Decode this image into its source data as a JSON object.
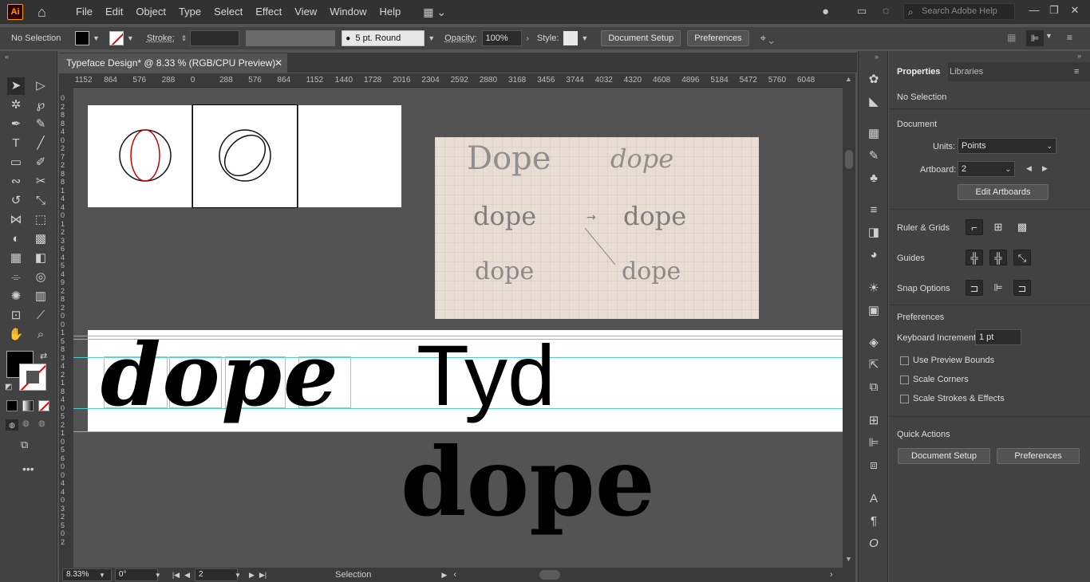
{
  "app": {
    "logo": "Ai"
  },
  "menu": [
    "File",
    "Edit",
    "Object",
    "Type",
    "Select",
    "Effect",
    "View",
    "Window",
    "Help"
  ],
  "search": {
    "placeholder": "Search Adobe Help"
  },
  "control": {
    "selection": "No Selection",
    "stroke_label": "Stroke:",
    "brush": "5 pt. Round",
    "opacity_label": "Opacity:",
    "opacity_value": "100%",
    "style_label": "Style:",
    "document_setup": "Document Setup",
    "preferences": "Preferences"
  },
  "document": {
    "tab_title": "Typeface Design* @ 8.33 % (RGB/CPU Preview)"
  },
  "ruler_top": [
    "1152",
    "864",
    "576",
    "288",
    "0",
    "288",
    "576",
    "864",
    "1152",
    "1440",
    "1728",
    "2016",
    "2304",
    "2592",
    "2880",
    "3168",
    "3456",
    "3744",
    "4032",
    "4320",
    "4608",
    "4896",
    "5184",
    "5472",
    "5760",
    "6048"
  ],
  "ruler_left": [
    "0",
    "2",
    "8",
    "8",
    "4",
    "0",
    "2",
    "7",
    "2",
    "8",
    "8",
    "1",
    "4",
    "4",
    "0",
    "1",
    "2",
    "3",
    "6",
    "4",
    "5",
    "4",
    "9",
    "2",
    "8",
    "2",
    "0",
    "0",
    "1",
    "5",
    "8",
    "3",
    "4",
    "2",
    "1",
    "8",
    "4",
    "0",
    "5",
    "2",
    "1",
    "0",
    "5",
    "6",
    "0",
    "0",
    "4",
    "4",
    "0",
    "3",
    "2",
    "5",
    "0",
    "2"
  ],
  "canvas": {
    "word_large": "dope",
    "word_tyd": "Tyd",
    "word_bottom": "dope"
  },
  "status": {
    "zoom": "8.33%",
    "rotation": "0°",
    "artboard_num": "2",
    "tool": "Selection"
  },
  "panel": {
    "tab_properties": "Properties",
    "tab_libraries": "Libraries",
    "no_selection": "No Selection",
    "document_heading": "Document",
    "units_label": "Units:",
    "units_value": "Points",
    "artboard_label": "Artboard:",
    "artboard_value": "2",
    "edit_artboards": "Edit Artboards",
    "ruler_grids": "Ruler & Grids",
    "guides": "Guides",
    "snap_options": "Snap Options",
    "preferences_heading": "Preferences",
    "keyboard_increment_label": "Keyboard Increment:",
    "keyboard_increment_value": "1 pt",
    "use_preview_bounds": "Use Preview Bounds",
    "scale_corners": "Scale Corners",
    "scale_strokes": "Scale Strokes & Effects",
    "quick_actions": "Quick Actions",
    "qa_document_setup": "Document Setup",
    "qa_preferences": "Preferences"
  },
  "colors": {
    "guide": "#4fd0d8",
    "accent": "#ff9a00",
    "stroke_red": "#cc0000"
  }
}
